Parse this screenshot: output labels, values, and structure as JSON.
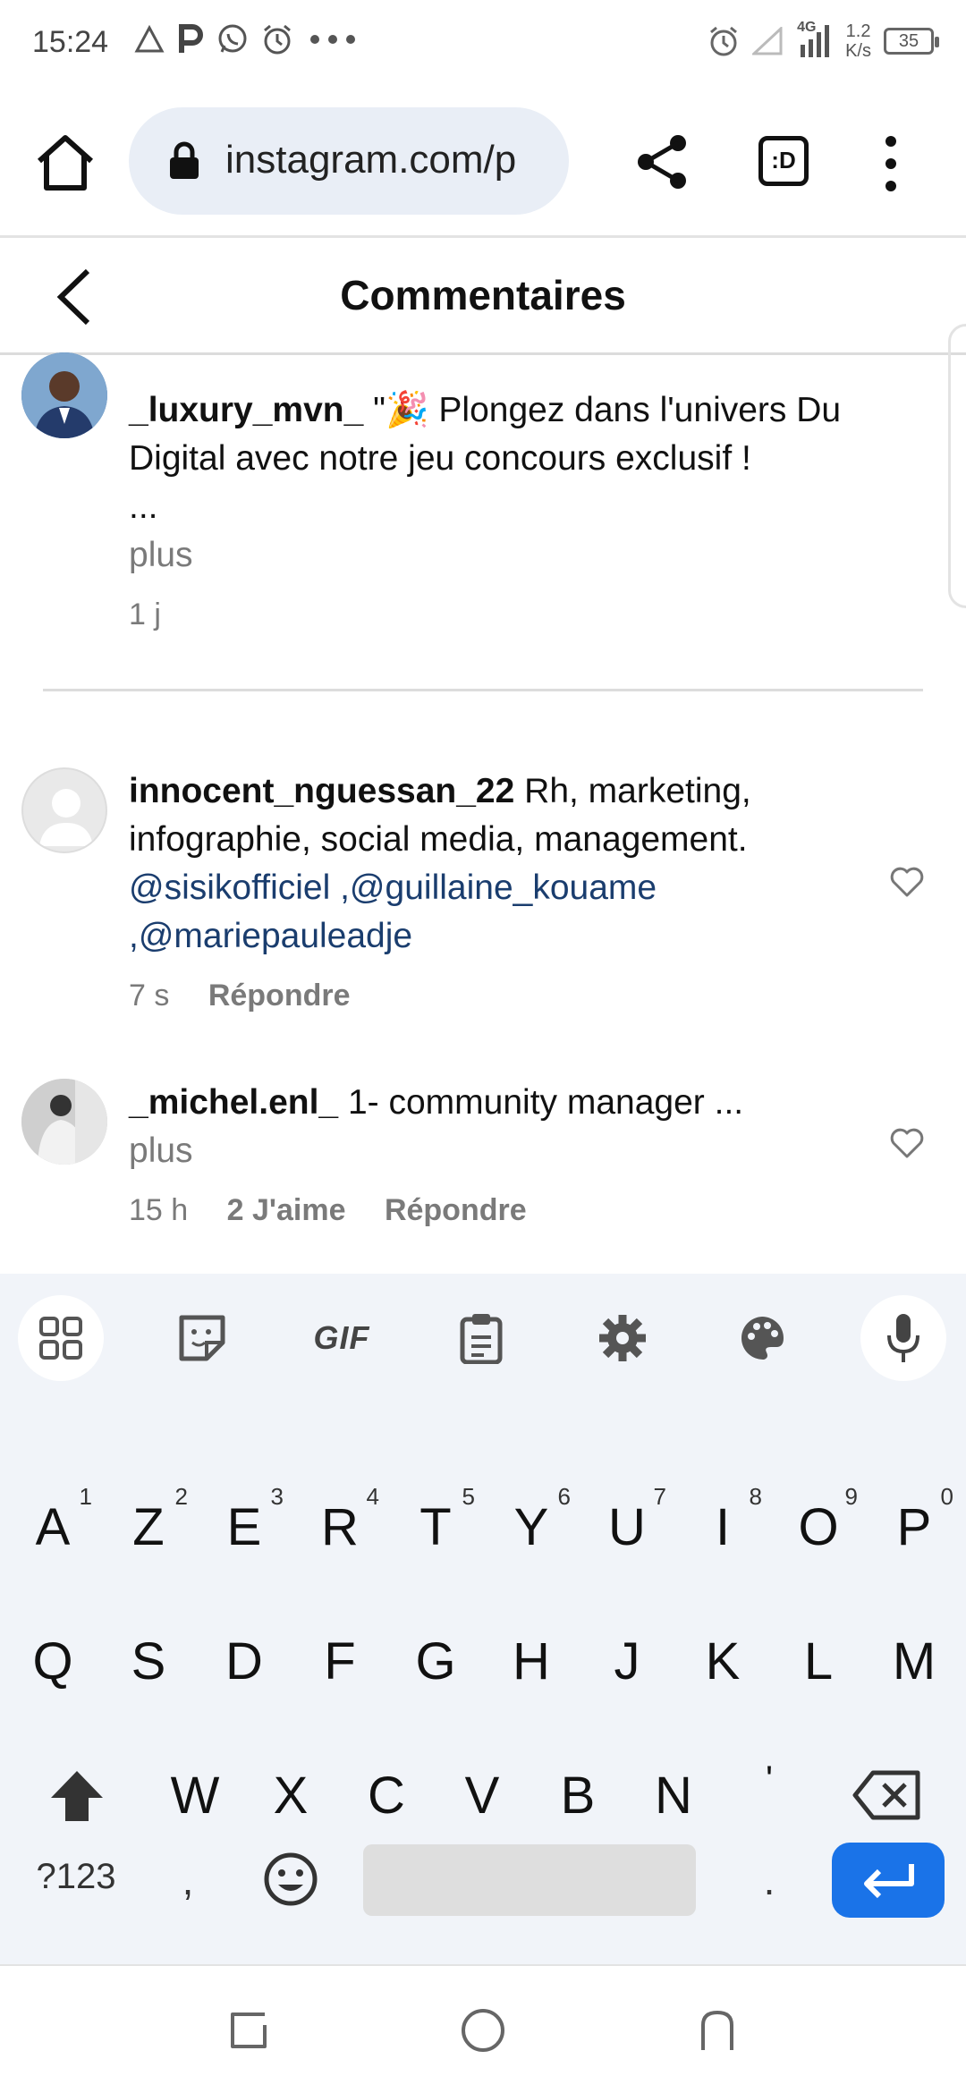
{
  "status_bar": {
    "time": "15:24",
    "network_type": "4G",
    "net_speed_value": "1.2",
    "net_speed_unit": "K/s",
    "battery": "35"
  },
  "browser": {
    "url": "instagram.com/p",
    "tabs_label": ":D"
  },
  "header": {
    "title": "Commentaires"
  },
  "caption": {
    "username": "_luxury_mvn_",
    "text": "\"🎉 Plongez dans l'univers Du Digital avec notre jeu concours exclusif !",
    "ellipsis": "...",
    "more": "plus",
    "time": "1 j"
  },
  "comments": [
    {
      "username": "innocent_nguessan_22",
      "text": "Rh, marketing, infographie, social media, management.",
      "mentions": "@sisikofficiel ,@guillaine_kouame ,@mariepauleadje",
      "time": "7 s",
      "reply": "Répondre"
    },
    {
      "username": "_michel.enl_",
      "text": "1- community manager ...",
      "more": "plus",
      "time": "15 h",
      "likes": "2 J'aime",
      "reply": "Répondre"
    }
  ],
  "keyboard": {
    "toolbar_gif": "GIF",
    "row1": [
      "A",
      "Z",
      "E",
      "R",
      "T",
      "Y",
      "U",
      "I",
      "O",
      "P"
    ],
    "row1_hints": [
      "1",
      "2",
      "3",
      "4",
      "5",
      "6",
      "7",
      "8",
      "9",
      "0"
    ],
    "row2": [
      "Q",
      "S",
      "D",
      "F",
      "G",
      "H",
      "J",
      "K",
      "L",
      "M"
    ],
    "row3": [
      "W",
      "X",
      "C",
      "V",
      "B",
      "N",
      "'"
    ],
    "symbols": "?123",
    "comma": ",",
    "period": "."
  },
  "colors": {
    "mention": "#1a3d6e",
    "enter_key": "#1a73e8",
    "url_pill": "#e9eef6",
    "keyboard_bg": "#f1f4f9"
  }
}
